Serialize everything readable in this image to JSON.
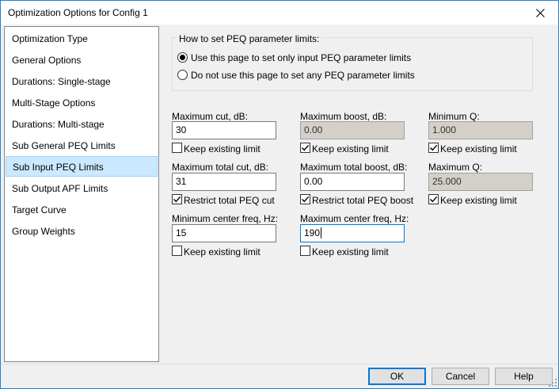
{
  "window": {
    "title": "Optimization Options for Config 1"
  },
  "nav": {
    "items": [
      {
        "label": "Optimization Type"
      },
      {
        "label": "General Options"
      },
      {
        "label": "Durations: Single-stage"
      },
      {
        "label": "Multi-Stage Options"
      },
      {
        "label": "Durations: Multi-stage"
      },
      {
        "label": "Sub General PEQ Limits"
      },
      {
        "label": "Sub Input PEQ Limits"
      },
      {
        "label": "Sub Output APF Limits"
      },
      {
        "label": "Target Curve"
      },
      {
        "label": "Group Weights"
      }
    ],
    "selected": "Sub Input PEQ Limits"
  },
  "limits_group": {
    "label": "How to set PEQ parameter limits:",
    "option_use": "Use this page to set only input PEQ parameter limits",
    "option_not_use": "Do not use this page to set any PEQ parameter limits",
    "selected": "option_use"
  },
  "fields": {
    "max_cut": {
      "label": "Maximum cut, dB:",
      "value": "30",
      "checkbox": "Keep existing limit",
      "checked": false
    },
    "max_boost": {
      "label": "Maximum boost, dB:",
      "value": "0.00",
      "checkbox": "Keep existing limit",
      "checked": true
    },
    "min_q": {
      "label": "Minimum Q:",
      "value": "1.000",
      "checkbox": "Keep existing limit",
      "checked": true
    },
    "max_total_cut": {
      "label": "Maximum total cut, dB:",
      "value": "31",
      "checkbox": "Restrict total PEQ cut",
      "checked": true
    },
    "max_total_boost": {
      "label": "Maximum total boost, dB:",
      "value": "0.00",
      "checkbox": "Restrict total PEQ boost",
      "checked": true
    },
    "max_q": {
      "label": "Maximum Q:",
      "value": "25.000",
      "checkbox": "Keep existing limit",
      "checked": true
    },
    "min_center_freq": {
      "label": "Minimum center freq, Hz:",
      "value": "15",
      "checkbox": "Keep existing limit",
      "checked": false
    },
    "max_center_freq": {
      "label": "Maximum center freq, Hz:",
      "value": "190",
      "checkbox": "Keep existing limit",
      "checked": false
    }
  },
  "buttons": {
    "ok": "OK",
    "cancel": "Cancel",
    "help": "Help"
  }
}
